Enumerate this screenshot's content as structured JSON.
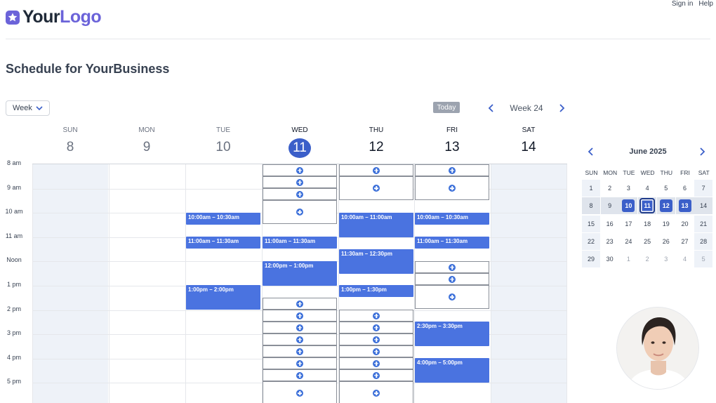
{
  "header": {
    "logo_your": "Your",
    "logo_logo": "Logo",
    "sign_in": "Sign in",
    "help": "Help",
    "accent": "#6b63d9"
  },
  "page": {
    "title": "Schedule for YourBusiness"
  },
  "toolbar": {
    "view_value": "Week",
    "today_label": "Today",
    "week_label": "Week 24"
  },
  "week": {
    "days": [
      {
        "name": "SUN",
        "num": "8"
      },
      {
        "name": "MON",
        "num": "9"
      },
      {
        "name": "TUE",
        "num": "10"
      },
      {
        "name": "WED",
        "num": "11"
      },
      {
        "name": "THU",
        "num": "12"
      },
      {
        "name": "FRI",
        "num": "13"
      },
      {
        "name": "SAT",
        "num": "14"
      }
    ],
    "today_index": 3,
    "hours": [
      "8 am",
      "9 am",
      "10 am",
      "11 am",
      "Noon",
      "1 pm",
      "2 pm",
      "3 pm",
      "4 pm",
      "5 pm"
    ],
    "events": [
      {
        "day": 2,
        "label": "10:00am – 10:30am"
      },
      {
        "day": 2,
        "label": "11:00am – 11:30am"
      },
      {
        "day": 2,
        "label": "1:00pm – 2:00pm"
      },
      {
        "day": 3,
        "label": "11:00am – 11:30am"
      },
      {
        "day": 3,
        "label": "12:00pm – 1:00pm"
      },
      {
        "day": 4,
        "label": "10:00am – 11:00am"
      },
      {
        "day": 4,
        "label": "11:30am – 12:30pm"
      },
      {
        "day": 4,
        "label": "1:00pm – 1:30pm"
      },
      {
        "day": 5,
        "label": "10:00am – 10:30am"
      },
      {
        "day": 5,
        "label": "11:00am – 11:30am"
      },
      {
        "day": 5,
        "label": "2:30pm – 3:30pm"
      },
      {
        "day": 5,
        "label": "4:00pm – 5:00pm"
      }
    ],
    "event_color": "#4a73e0"
  },
  "mini_calendar": {
    "month_label": "June 2025",
    "dow": [
      "SUN",
      "MON",
      "TUE",
      "WED",
      "THU",
      "FRI",
      "SAT"
    ],
    "weeks": [
      [
        "1",
        "2",
        "3",
        "4",
        "5",
        "6",
        "7"
      ],
      [
        "8",
        "9",
        "10",
        "11",
        "12",
        "13",
        "14"
      ],
      [
        "15",
        "16",
        "17",
        "18",
        "19",
        "20",
        "21"
      ],
      [
        "22",
        "23",
        "24",
        "25",
        "26",
        "27",
        "28"
      ],
      [
        "29",
        "30",
        "1",
        "2",
        "3",
        "4",
        "5"
      ]
    ],
    "available_dates": [
      "10",
      "11",
      "12",
      "13"
    ],
    "selected_date": "11"
  }
}
